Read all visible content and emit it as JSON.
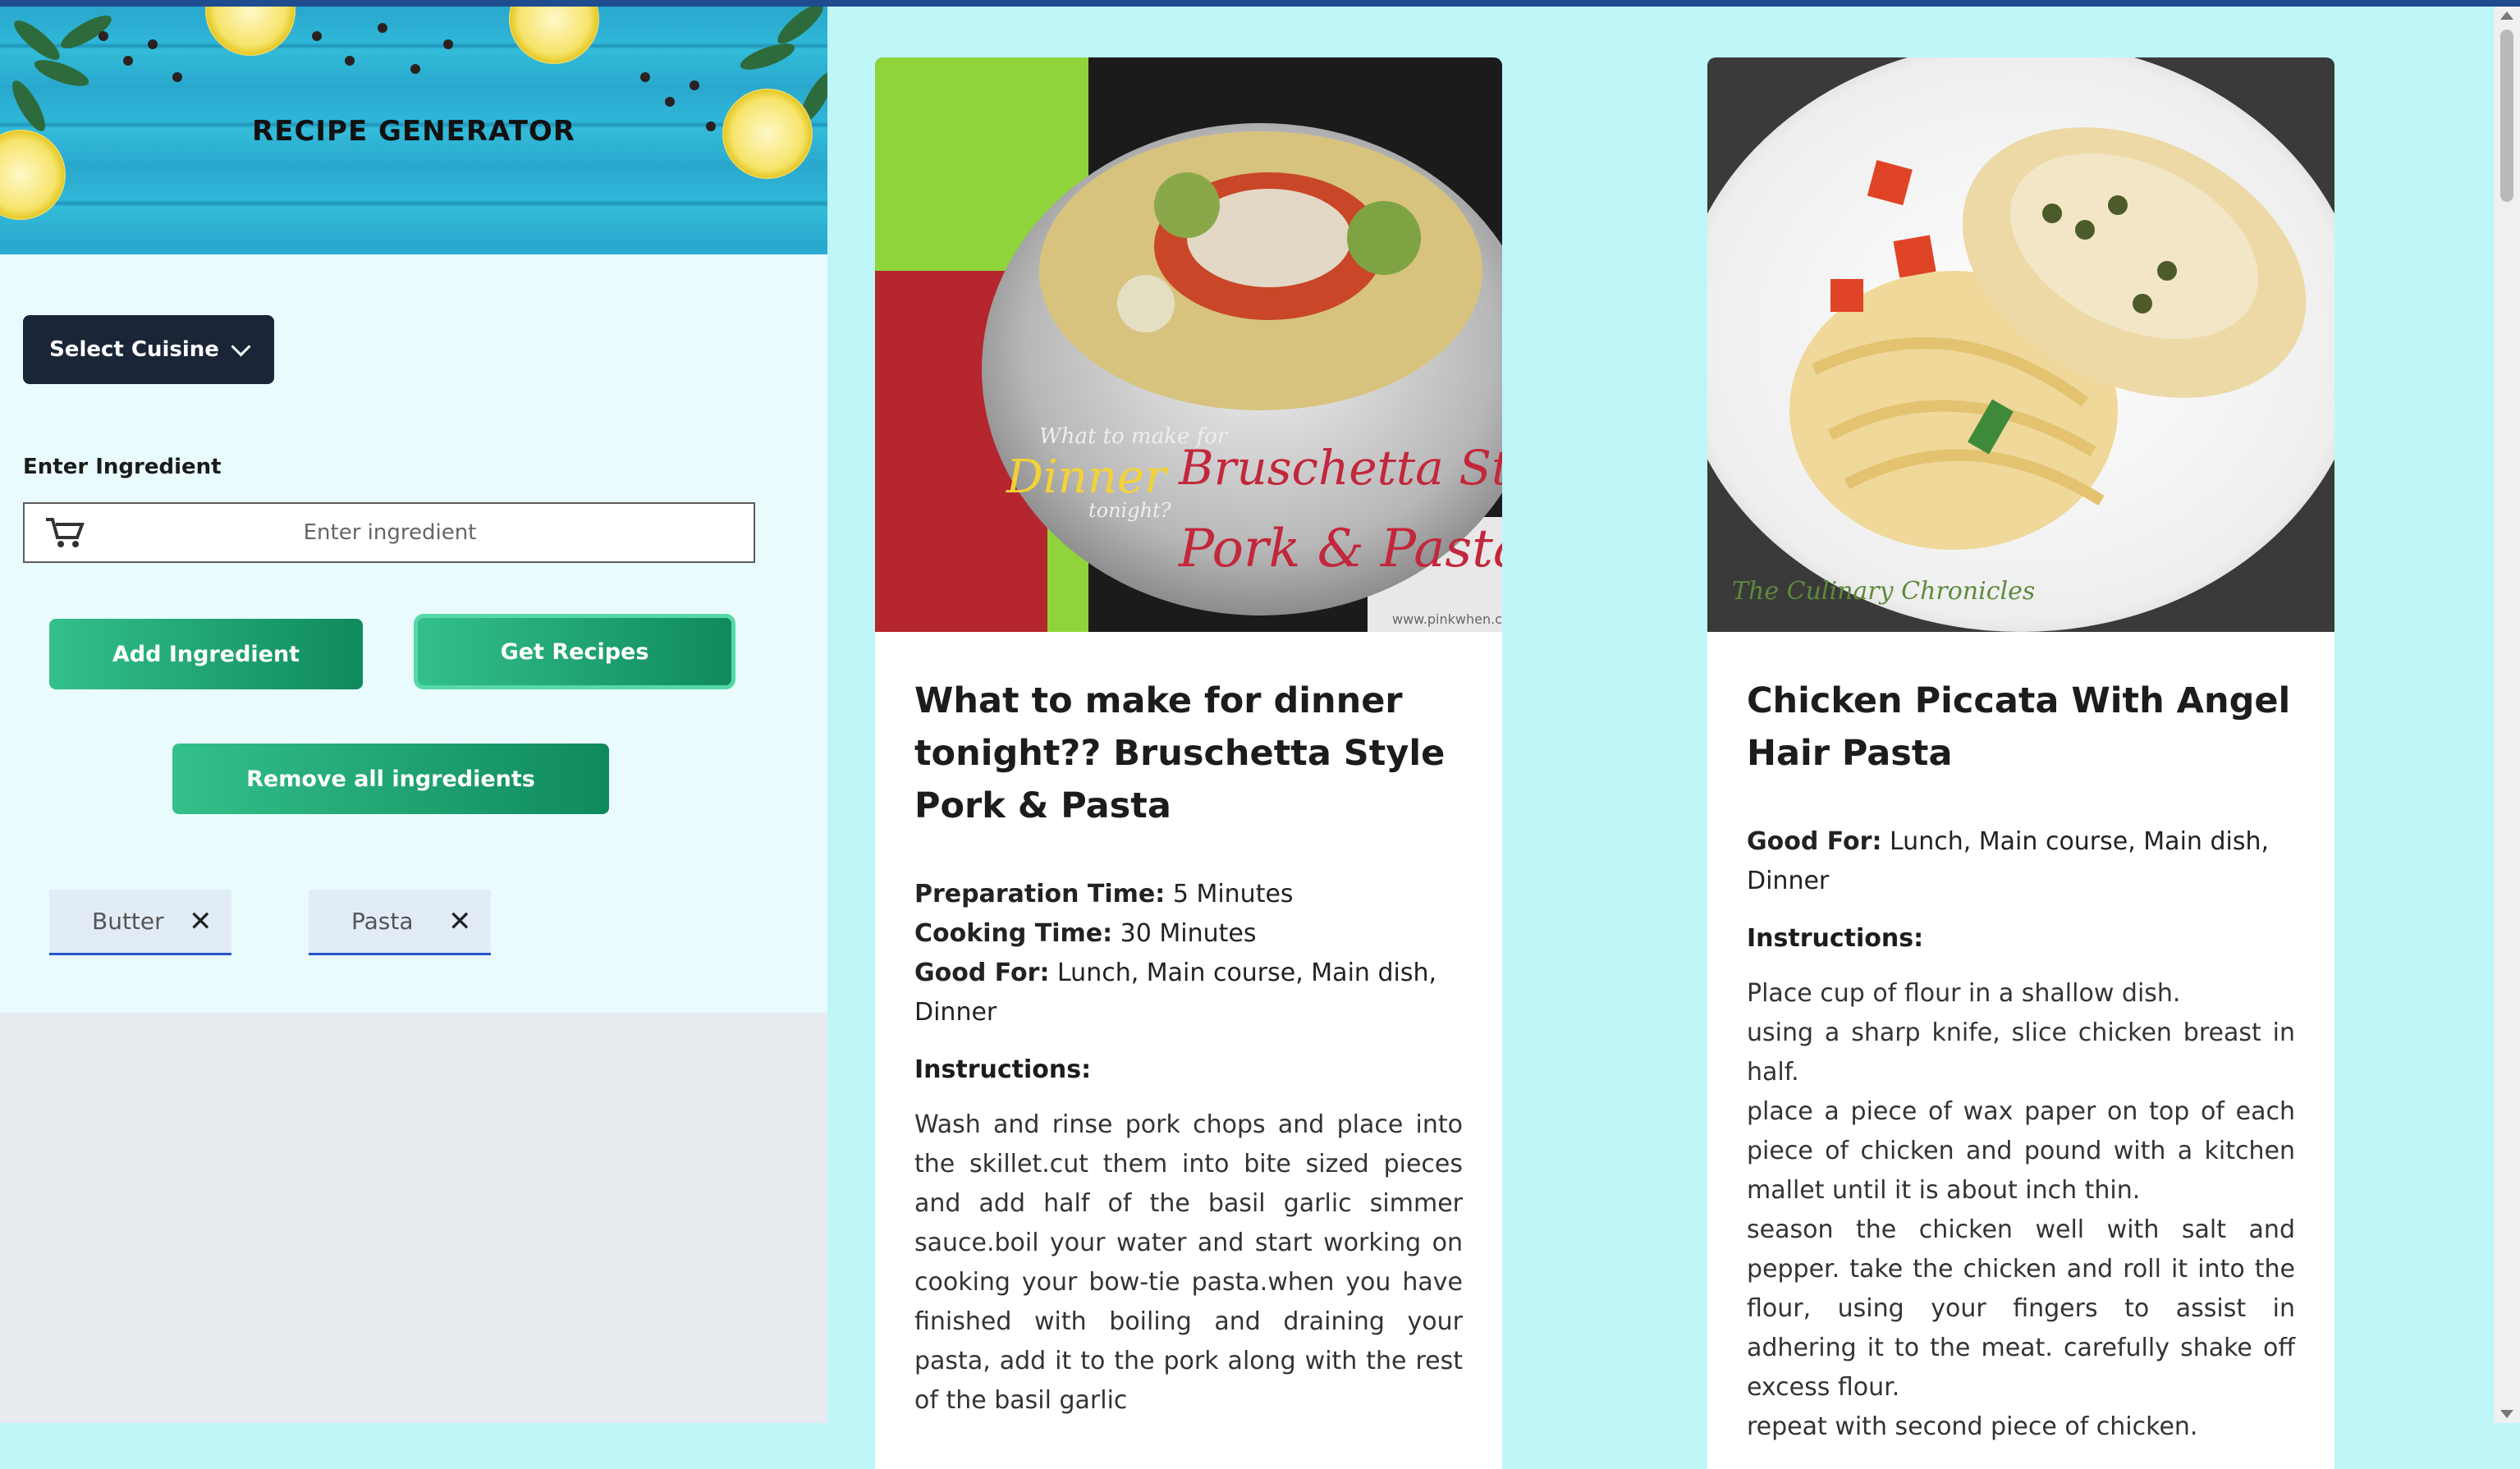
{
  "app": {
    "title": "RECIPE GENERATOR"
  },
  "sidebar": {
    "cuisine_button": "Select Cuisine",
    "ingredient_label": "Enter Ingredient",
    "ingredient_placeholder": "Enter ingredient",
    "add_button": "Add Ingredient",
    "get_button": "Get Recipes",
    "remove_button": "Remove all ingredients",
    "chips": [
      "Butter",
      "Pasta"
    ]
  },
  "recipes": [
    {
      "title": "What to make for dinner tonight?? Bruschetta Style Pork & Pasta",
      "prep_label": "Preparation Time:",
      "prep_value": "5 Minutes",
      "cook_label": "Cooking Time:",
      "cook_value": "30 Minutes",
      "goodfor_label": "Good For:",
      "goodfor_value": "Lunch, Main course, Main dish, Dinner",
      "instructions_label": "Instructions:",
      "instructions": "Wash and rinse pork chops and place into the skillet.cut them into bite sized pieces and add half of the basil garlic simmer sauce.boil your water and start working on cooking your bow-tie pasta.when you have finished with boiling and draining your pasta, add it to the pork along with the rest of the basil garlic",
      "image_caption_1": "What to make for",
      "image_caption_2": "Dinner",
      "image_caption_3": "tonight?",
      "image_caption_4": "Bruschetta Style",
      "image_caption_5": "Pork & Pasta",
      "image_caption_6": "www.pinkwhen.com"
    },
    {
      "title": "Chicken Piccata With Angel Hair Pasta",
      "goodfor_label": "Good For:",
      "goodfor_value": "Lunch, Main course, Main dish, Dinner",
      "instructions_label": "Instructions:",
      "instructions_lines": [
        "Place cup of flour in a shallow dish.",
        "using a sharp knife, slice chicken breast in half.",
        "place a piece of wax paper on top of each piece of chicken and pound with a kitchen mallet until it is about inch thin.",
        "season the chicken well with salt and pepper. take the chicken and roll it into the flour, using your fingers to assist in adhering it to the meat. carefully shake off excess flour.",
        "repeat with second piece of chicken."
      ],
      "image_caption": "The Culinary Chronicles"
    }
  ]
}
